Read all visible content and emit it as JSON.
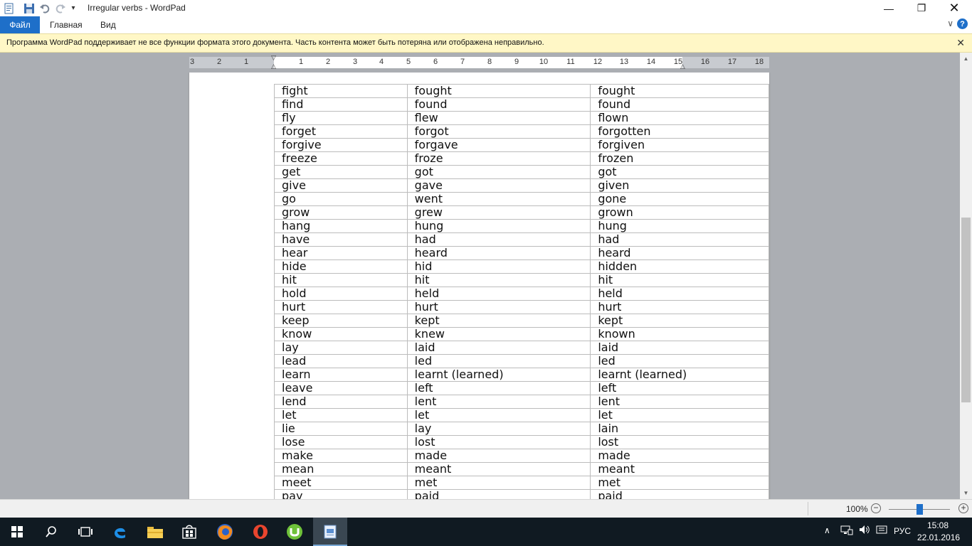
{
  "window": {
    "title": "Irregular verbs - WordPad",
    "minimize_icon": "minimize-icon",
    "maximize_icon": "restore-icon",
    "close_icon": "close-icon"
  },
  "quick_access": [
    "wordpad-app-icon",
    "save-icon",
    "undo-icon",
    "redo-icon",
    "customize-dropdown-icon"
  ],
  "menu": {
    "file_tab": "Файл",
    "tabs": [
      "Главная",
      "Вид"
    ]
  },
  "infobar": {
    "message": "Программа WordPad поддерживает не все функции формата этого документа. Часть контента может быть потеряна или отображена неправильно.",
    "background": "#fff7c6"
  },
  "ruler": {
    "labels": [
      "3",
      "2",
      "1",
      "1",
      "2",
      "3",
      "4",
      "5",
      "6",
      "7",
      "8",
      "9",
      "10",
      "11",
      "12",
      "13",
      "14",
      "15",
      "16",
      "17",
      "18"
    ]
  },
  "table": {
    "rows": [
      [
        "fight",
        "fought",
        "fought"
      ],
      [
        "find",
        "found",
        "found"
      ],
      [
        "fly",
        "flew",
        "flown"
      ],
      [
        "forget",
        "forgot",
        "forgotten"
      ],
      [
        "forgive",
        "forgave",
        "forgiven"
      ],
      [
        "freeze",
        "froze",
        "frozen"
      ],
      [
        "get",
        "got",
        "got"
      ],
      [
        "give",
        "gave",
        "given"
      ],
      [
        "go",
        "went",
        "gone"
      ],
      [
        "grow",
        "grew",
        "grown"
      ],
      [
        "hang",
        "hung",
        "hung"
      ],
      [
        "have",
        "had",
        "had"
      ],
      [
        "hear",
        "heard",
        "heard"
      ],
      [
        "hide",
        "hid",
        "hidden"
      ],
      [
        "hit",
        "hit",
        "hit"
      ],
      [
        "hold",
        "held",
        "held"
      ],
      [
        "hurt",
        "hurt",
        "hurt"
      ],
      [
        "keep",
        "kept",
        "kept"
      ],
      [
        "know",
        "knew",
        "known"
      ],
      [
        "lay",
        "laid",
        "laid"
      ],
      [
        "lead",
        "led",
        "led"
      ],
      [
        "learn",
        "learnt (learned)",
        "learnt (learned)"
      ],
      [
        "leave",
        "left",
        "left"
      ],
      [
        "lend",
        "lent",
        "lent"
      ],
      [
        "let",
        "let",
        "let"
      ],
      [
        "lie",
        "lay",
        "lain"
      ],
      [
        "lose",
        "lost",
        "lost"
      ],
      [
        "make",
        "made",
        "made"
      ],
      [
        "mean",
        "meant",
        "meant"
      ],
      [
        "meet",
        "met",
        "met"
      ],
      [
        "pay",
        "paid",
        "paid"
      ]
    ]
  },
  "statusbar": {
    "zoom": "100%",
    "zoom_percent": 100
  },
  "taskbar": {
    "icons": [
      "windows-start-icon",
      "search-icon",
      "task-view-icon",
      "edge-icon",
      "file-explorer-icon",
      "store-icon",
      "firefox-icon",
      "opera-icon",
      "utorrent-icon",
      "wordpad-icon"
    ],
    "language": "РУС",
    "time": "15:08",
    "date": "22.01.2016"
  },
  "colors": {
    "accent": "#1e6fc9",
    "taskbar": "#101a22",
    "workspace": "#abaeb3"
  }
}
